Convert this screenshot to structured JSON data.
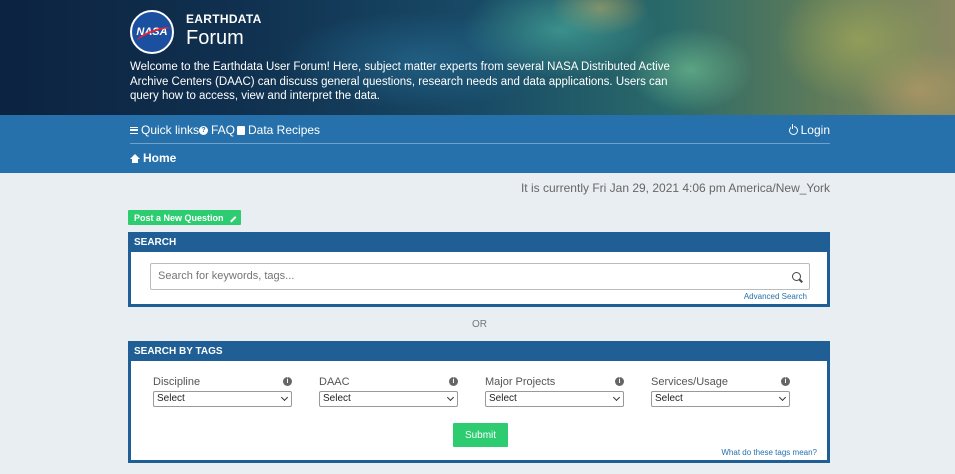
{
  "header": {
    "logo_text": "NASA",
    "brand_top": "EARTHDATA",
    "brand_main": "Forum",
    "welcome": "Welcome to the Earthdata User Forum! Here, subject matter experts from several NASA Distributed Active Archive Centers (DAAC) can discuss general questions, research needs and data applications. Users can query how to access, view and interpret the data."
  },
  "nav": {
    "quick_links": "Quick links",
    "faq": "FAQ",
    "data_recipes": "Data Recipes",
    "login": "Login",
    "home": "Home"
  },
  "current_time": "It is currently Fri Jan 29, 2021 4:06 pm America/New_York",
  "post_button": "Post a New Question",
  "search": {
    "title": "SEARCH",
    "placeholder": "Search for keywords, tags...",
    "advanced": "Advanced Search"
  },
  "or_text": "OR",
  "tags": {
    "title": "SEARCH BY TAGS",
    "columns": [
      {
        "label": "Discipline",
        "selected": "Select"
      },
      {
        "label": "DAAC",
        "selected": "Select"
      },
      {
        "label": "Major Projects",
        "selected": "Select"
      },
      {
        "label": "Services/Usage",
        "selected": "Select"
      }
    ],
    "submit": "Submit",
    "help": "What do these tags mean?"
  },
  "colors": {
    "nav_blue": "#2671ac",
    "panel_blue": "#1f5f95",
    "accent_green": "#2ecc71"
  }
}
